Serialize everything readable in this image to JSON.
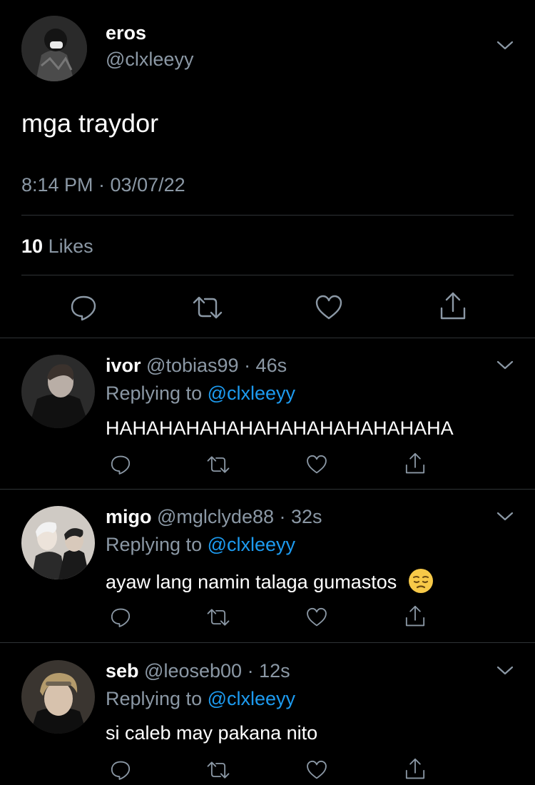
{
  "main_tweet": {
    "author_name": "eros",
    "author_handle": "@clxleeyy",
    "text": "mga traydor",
    "timestamp": "8:14 PM · 03/07/22",
    "likes_count": "10",
    "likes_label": "Likes"
  },
  "replies": [
    {
      "name": "ivor",
      "handle": "@tobias99",
      "time": "· 46s",
      "replying_prefix": "Replying to",
      "replying_to": "@clxleeyy",
      "text": "HAHAHAHAHAHAHAHAHAHAHAHAHA"
    },
    {
      "name": "migo",
      "handle": "@mglclyde88",
      "time": "· 32s",
      "replying_prefix": "Replying to",
      "replying_to": "@clxleeyy",
      "text": "ayaw lang namin talaga gumastos",
      "emoji": "pensive-face"
    },
    {
      "name": "seb",
      "handle": "@leoseb00",
      "time": "· 12s",
      "replying_prefix": "Replying to",
      "replying_to": "@clxleeyy",
      "text": "si caleb may pakana nito"
    }
  ],
  "colors": {
    "background": "#000000",
    "text": "#ffffff",
    "secondary": "#8b98a5",
    "link": "#1d9bf0",
    "divider": "#2f3336"
  }
}
